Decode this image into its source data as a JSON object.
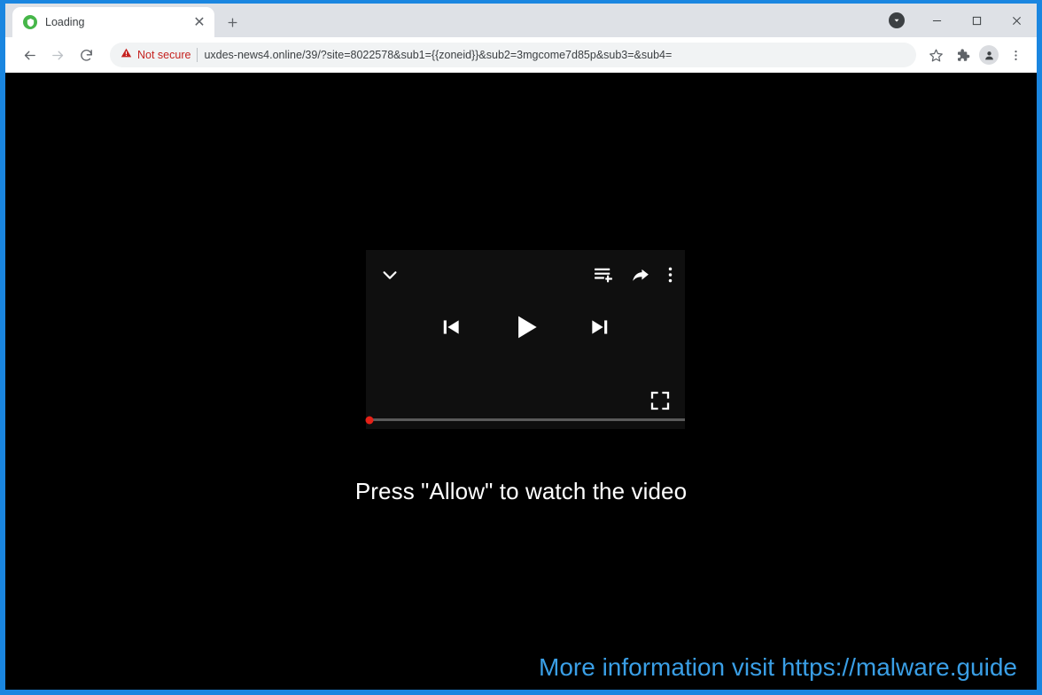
{
  "window": {
    "frame_color": "#1a86e0",
    "controls": {
      "download_icon": "download-circle-icon",
      "minimize_label": "—",
      "maximize_label": "❐",
      "close_label": "✕"
    }
  },
  "tabstrip": {
    "active_tab": {
      "title": "Loading",
      "favicon": "green-circle-favicon",
      "close_label": "✕"
    },
    "new_tab_label": "+"
  },
  "toolbar": {
    "back_label": "←",
    "forward_label": "→",
    "reload_label": "↻",
    "security": {
      "icon": "warning-triangle-icon",
      "label": "Not secure"
    },
    "url": "uxdes-news4.online/39/?site=8022578&sub1={{zoneid}}&sub2=3mgcome7d85p&sub3=&sub4=",
    "bookmark_icon": "star-icon",
    "extensions_icon": "puzzle-piece-icon",
    "profile_icon": "person-avatar-icon",
    "menu_icon": "three-dots-vertical-icon"
  },
  "page": {
    "background_color": "#000000",
    "player": {
      "background_color": "#0f0f0f",
      "collapse_icon": "chevron-down-icon",
      "queue_icon": "add-to-queue-icon",
      "share_icon": "share-arrow-icon",
      "more_icon": "three-dots-vertical-icon",
      "previous_icon": "skip-previous-icon",
      "play_icon": "play-icon",
      "next_icon": "skip-next-icon",
      "fullscreen_icon": "fullscreen-icon",
      "progress_percent": 0,
      "scrubber_color": "#e62117",
      "track_color": "#5a5a5a"
    },
    "allow_message": "Press \"Allow\" to watch the video",
    "watermark": {
      "text": "More information visit https://malware.guide",
      "color": "#3a9fe6"
    }
  }
}
